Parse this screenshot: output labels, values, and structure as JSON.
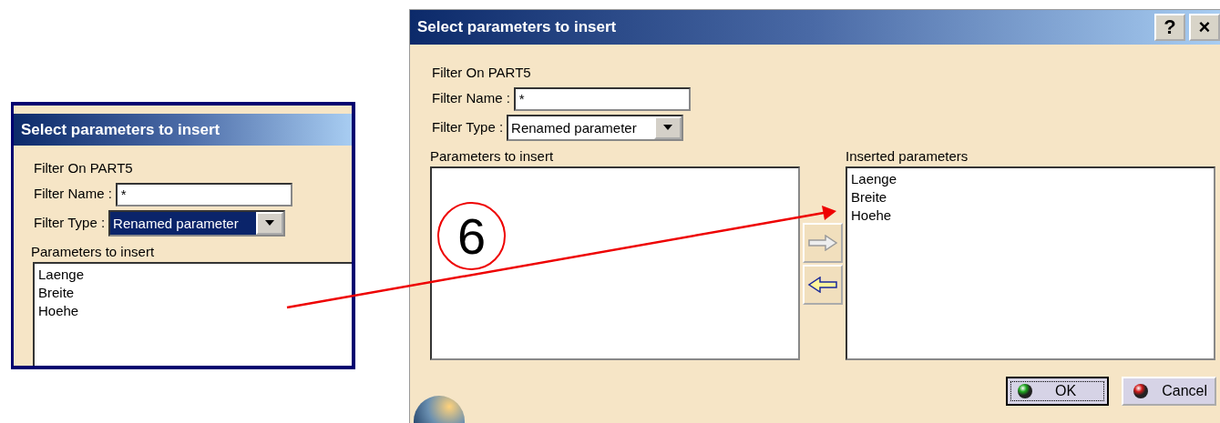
{
  "snippet": {
    "title": "Select parameters to insert",
    "filter_on": "Filter On PART5",
    "filter_name_label": "Filter Name :",
    "filter_name_value": "*",
    "filter_type_label": "Filter Type :",
    "filter_type_value": "Renamed parameter",
    "filter_type_focused": true,
    "list_label": "Parameters to insert",
    "parameters": [
      "Laenge",
      "Breite",
      "Hoehe"
    ]
  },
  "dialog": {
    "title": "Select parameters to insert",
    "title_buttons": [
      "?",
      "×"
    ],
    "filter_on": "Filter On PART5",
    "filter_name_label": "Filter Name :",
    "filter_name_value": "*",
    "filter_type_label": "Filter Type :",
    "filter_type_value": "Renamed parameter",
    "filter_type_focused": false,
    "list_label": "Parameters to insert",
    "inserted_label": "Inserted parameters",
    "inserted": [
      "Laenge",
      "Breite",
      "Hoehe"
    ],
    "move_buttons": [
      {
        "kind": "add",
        "disabled": true
      },
      {
        "kind": "remove",
        "disabled": false
      }
    ],
    "buttons": [
      {
        "label": "OK",
        "kind": "ok",
        "default": true
      },
      {
        "label": "Cancel",
        "kind": "cancel",
        "default": false
      }
    ]
  },
  "step_marker": "6"
}
